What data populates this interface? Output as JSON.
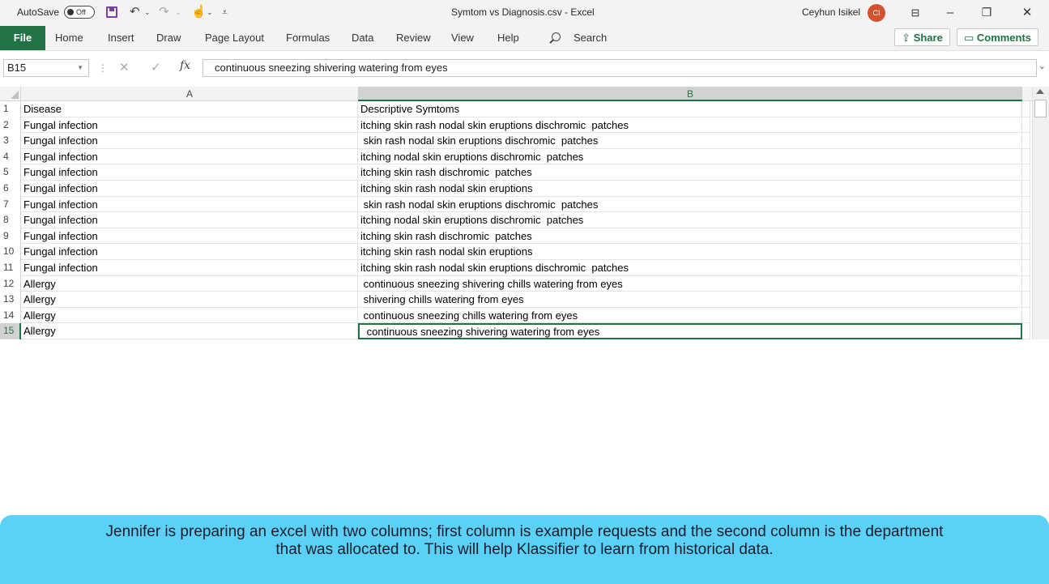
{
  "titlebar": {
    "autosave_label": "AutoSave",
    "autosave_state": "Off",
    "title": "Symtom vs Diagnosis.csv  -  Excel",
    "user_name": "Ceyhun Isikel",
    "user_initials": "CI"
  },
  "ribbon": {
    "file_label": "File",
    "tabs": [
      "Home",
      "Insert",
      "Draw",
      "Page Layout",
      "Formulas",
      "Data",
      "Review",
      "View",
      "Help"
    ],
    "search_label": "Search",
    "share_label": "Share",
    "comments_label": "Comments"
  },
  "formula_bar": {
    "name_box": "B15",
    "formula": "continuous sneezing shivering watering from eyes"
  },
  "sheet": {
    "col_headers": [
      "A",
      "B"
    ],
    "rows": [
      {
        "n": "1",
        "a": "Disease",
        "b": "Descriptive Symtoms"
      },
      {
        "n": "2",
        "a": "Fungal infection",
        "b": "itching skin rash nodal skin eruptions dischromic  patches"
      },
      {
        "n": "3",
        "a": "Fungal infection",
        "b": " skin rash nodal skin eruptions dischromic  patches"
      },
      {
        "n": "4",
        "a": "Fungal infection",
        "b": "itching nodal skin eruptions dischromic  patches"
      },
      {
        "n": "5",
        "a": "Fungal infection",
        "b": "itching skin rash dischromic  patches"
      },
      {
        "n": "6",
        "a": "Fungal infection",
        "b": "itching skin rash nodal skin eruptions"
      },
      {
        "n": "7",
        "a": "Fungal infection",
        "b": " skin rash nodal skin eruptions dischromic  patches"
      },
      {
        "n": "8",
        "a": "Fungal infection",
        "b": "itching nodal skin eruptions dischromic  patches"
      },
      {
        "n": "9",
        "a": "Fungal infection",
        "b": "itching skin rash dischromic  patches"
      },
      {
        "n": "10",
        "a": "Fungal infection",
        "b": "itching skin rash nodal skin eruptions"
      },
      {
        "n": "11",
        "a": "Fungal infection",
        "b": "itching skin rash nodal skin eruptions dischromic  patches"
      },
      {
        "n": "12",
        "a": "Allergy",
        "b": " continuous sneezing shivering chills watering from eyes"
      },
      {
        "n": "13",
        "a": "Allergy",
        "b": " shivering chills watering from eyes"
      },
      {
        "n": "14",
        "a": "Allergy",
        "b": " continuous sneezing chills watering from eyes"
      },
      {
        "n": "15",
        "a": "Allergy",
        "b": " continuous sneezing shivering watering from eyes"
      }
    ]
  },
  "caption": {
    "text": "Jennifer is preparing an excel with two columns; first column is example requests and the second column is the department\nthat was allocated to. This will help Klassifier to learn from historical data."
  }
}
